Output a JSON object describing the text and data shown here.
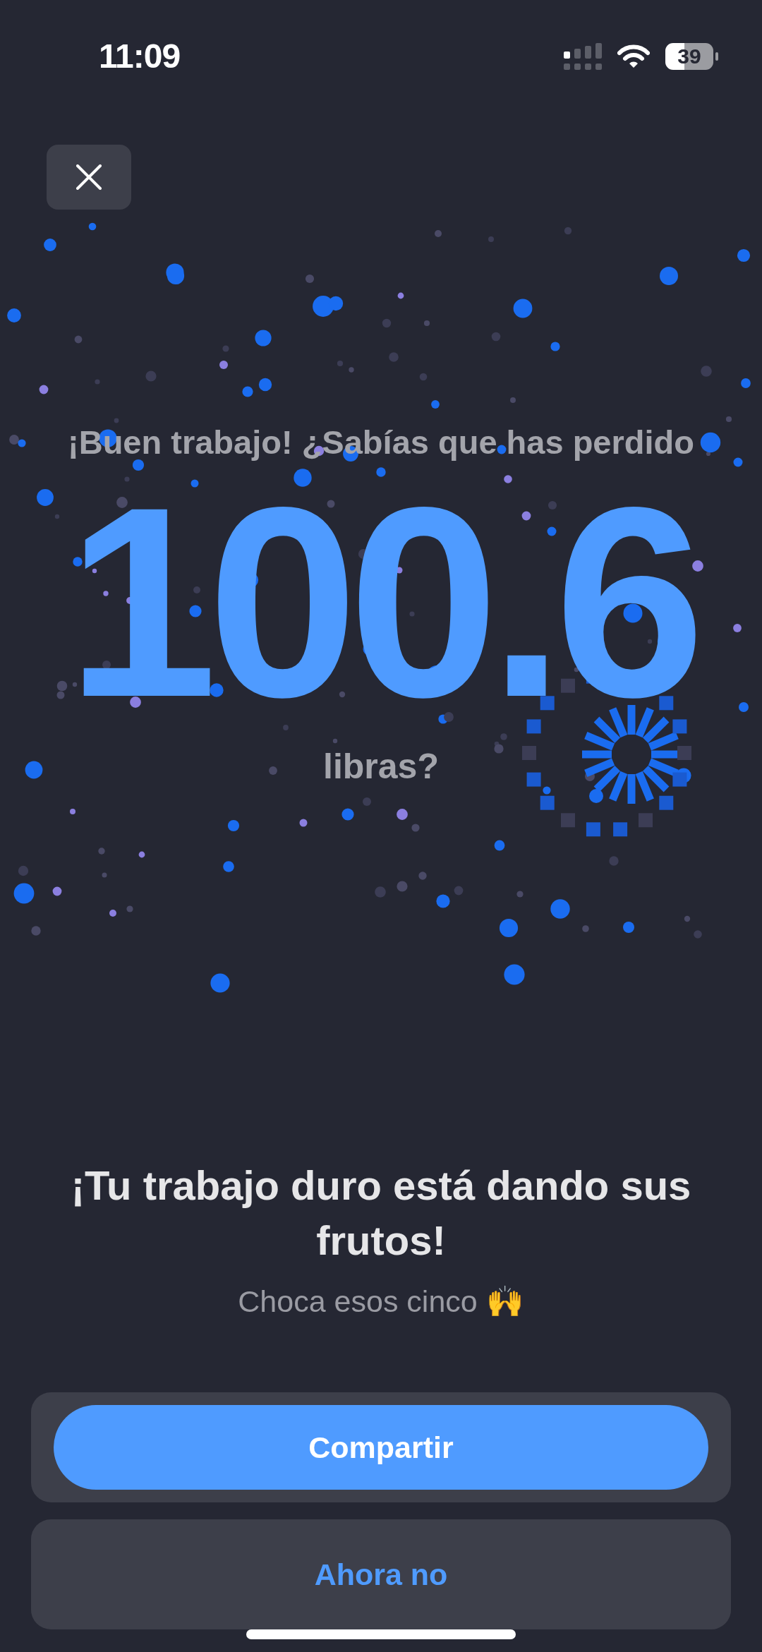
{
  "status_bar": {
    "time": "11:09",
    "battery": "39"
  },
  "hero": {
    "intro": "¡Buen trabajo! ¿Sabías que has perdido",
    "value": "100.6",
    "unit": "libras?"
  },
  "message": {
    "title": "¡Tu trabajo duro está dando sus frutos!",
    "subtitle": "Choca esos cinco 🙌"
  },
  "actions": [
    {
      "label": "Compartir",
      "kind": "primary"
    },
    {
      "label": "Ahora no",
      "kind": "secondary"
    }
  ]
}
